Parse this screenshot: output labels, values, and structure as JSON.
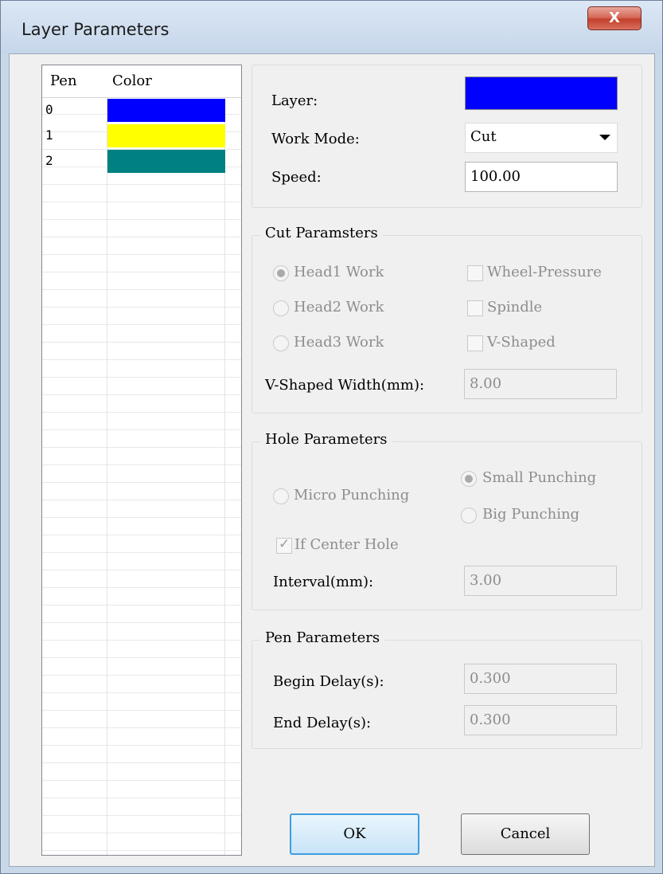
{
  "window": {
    "title": "Layer Parameters",
    "close_label": "X"
  },
  "pen_table": {
    "columns": [
      "Pen",
      "Color"
    ],
    "rows": [
      {
        "pen": "0",
        "color": "#0000ff"
      },
      {
        "pen": "1",
        "color": "#ffff00"
      },
      {
        "pen": "2",
        "color": "#008080"
      }
    ]
  },
  "layer": {
    "layer_label": "Layer:",
    "layer_color": "#0000ff",
    "work_mode_label": "Work Mode:",
    "work_mode_value": "Cut",
    "speed_label": "Speed:",
    "speed_value": "100.00"
  },
  "cut": {
    "title": "Cut Paramsters",
    "head1": "Head1 Work",
    "head2": "Head2 Work",
    "head3": "Head3 Work",
    "selected_head": "Head1 Work",
    "wheel_pressure": "Wheel-Pressure",
    "spindle": "Spindle",
    "v_shaped": "V-Shaped",
    "v_width_label": "V-Shaped Width(mm):",
    "v_width_value": "8.00"
  },
  "hole": {
    "title": "Hole Parameters",
    "micro": "Micro Punching",
    "small": "Small Punching",
    "big": "Big Punching",
    "selected": "Small Punching",
    "center_hole": "If Center Hole",
    "center_hole_checked": true,
    "interval_label": "Interval(mm):",
    "interval_value": "3.00"
  },
  "pen": {
    "title": "Pen Parameters",
    "begin_label": "Begin Delay(s):",
    "begin_value": "0.300",
    "end_label": "End Delay(s):",
    "end_value": "0.300"
  },
  "buttons": {
    "ok": "OK",
    "cancel": "Cancel"
  }
}
